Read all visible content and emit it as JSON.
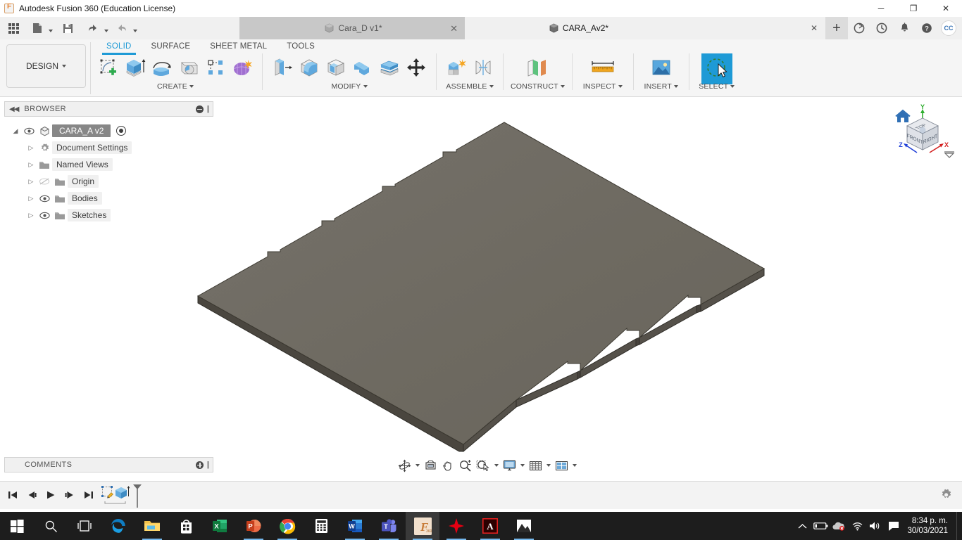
{
  "window": {
    "title": "Autodesk Fusion 360 (Education License)",
    "app_icon": "fusion-logo-icon",
    "minimize": "─",
    "maximize": "❐",
    "close": "✕"
  },
  "quick_access": {
    "grid_label": "app-grid",
    "new_label": "new-document",
    "save_label": "save",
    "undo_label": "undo",
    "redo_label": "redo"
  },
  "document_tabs": [
    {
      "label": "Cara_D v1*",
      "active": false,
      "close": "✕"
    },
    {
      "label": "CARA_Av2*",
      "active": true,
      "close": "✕"
    }
  ],
  "tab_actions": {
    "new_tab": "+",
    "extensions": "extensions-icon",
    "job_status": "job-status-icon",
    "notifications": "bell-icon",
    "help": "help-icon",
    "account_initials": "CC"
  },
  "ribbon": {
    "workspace": "DESIGN",
    "workspace_caret": "▾",
    "environment_tabs": [
      {
        "label": "SOLID",
        "active": true
      },
      {
        "label": "SURFACE",
        "active": false
      },
      {
        "label": "SHEET METAL",
        "active": false
      },
      {
        "label": "TOOLS",
        "active": false
      }
    ],
    "panels": [
      {
        "label": "CREATE",
        "has_caret": true,
        "commands": [
          "create-sketch-icon",
          "extrude-icon",
          "revolve-icon",
          "sweep-icon",
          "pattern-icon",
          "form-icon"
        ]
      },
      {
        "label": "MODIFY",
        "has_caret": true,
        "commands": [
          "press-pull-icon",
          "fillet-icon",
          "shell-icon",
          "combine-icon",
          "split-face-icon",
          "move-copy-icon"
        ]
      },
      {
        "label": "ASSEMBLE",
        "has_caret": true,
        "commands": [
          "new-component-icon",
          "joint-icon"
        ]
      },
      {
        "label": "CONSTRUCT",
        "has_caret": true,
        "commands": [
          "offset-plane-icon"
        ]
      },
      {
        "label": "INSPECT",
        "has_caret": true,
        "commands": [
          "measure-icon"
        ]
      },
      {
        "label": "INSERT",
        "has_caret": true,
        "commands": [
          "insert-image-icon"
        ]
      },
      {
        "label": "SELECT",
        "has_caret": true,
        "commands": [
          "select-tool-icon"
        ],
        "selected": true
      }
    ]
  },
  "browser": {
    "title": "BROWSER",
    "collapse_icon": "collapse-left-icon",
    "minimize_icon": "minimize-icon",
    "tree": [
      {
        "label": "CARA_A v2",
        "level": 0,
        "eye": true,
        "icon": "component-cube-icon",
        "selected": true,
        "radio": true
      },
      {
        "label": "Document Settings",
        "level": 1,
        "eye": false,
        "icon": "gear-icon"
      },
      {
        "label": "Named Views",
        "level": 1,
        "eye": false,
        "icon": "folder-icon"
      },
      {
        "label": "Origin",
        "level": 2,
        "eye": true,
        "eye_off": true,
        "icon": "folder-icon"
      },
      {
        "label": "Bodies",
        "level": 2,
        "eye": true,
        "icon": "folder-icon"
      },
      {
        "label": "Sketches",
        "level": 2,
        "eye": true,
        "icon": "folder-icon"
      }
    ]
  },
  "comments": {
    "title": "COMMENTS",
    "add_icon": "add-comment-icon"
  },
  "canvas": {
    "model_name": "CARA_A plate body",
    "face_color_top": "#6e6a61",
    "face_color_side": "#4f4c46",
    "face_color_edge": "#3a3832",
    "background": "#ffffff"
  },
  "view_cube": {
    "home_icon": "home-icon",
    "faces": {
      "top": "TOP",
      "front": "FRONT",
      "right": "RIGHT"
    },
    "axes": [
      {
        "label": "X",
        "color": "#d32020"
      },
      {
        "label": "Y",
        "color": "#2fae2f"
      },
      {
        "label": "Z",
        "color": "#2040d8"
      }
    ],
    "menu_icon": "viewcube-menu-icon"
  },
  "nav_bar": {
    "buttons": [
      {
        "name": "orbit-icon",
        "caret": true
      },
      {
        "name": "look-at-icon",
        "caret": false
      },
      {
        "name": "pan-icon",
        "caret": false
      },
      {
        "name": "zoom-icon",
        "caret": false
      },
      {
        "name": "zoom-window-icon",
        "caret": true
      },
      {
        "name": "display-settings-icon",
        "caret": true
      },
      {
        "name": "grid-snaps-icon",
        "caret": true
      },
      {
        "name": "viewports-icon",
        "caret": true
      }
    ]
  },
  "timeline": {
    "buttons": [
      "go-to-beginning-icon",
      "step-back-icon",
      "play-icon",
      "step-forward-icon",
      "go-to-end-icon"
    ],
    "features": [
      {
        "name": "sketch-feature-icon"
      },
      {
        "name": "extrude-feature-icon"
      }
    ],
    "marker": "timeline-marker",
    "settings": "timeline-settings-gear-icon"
  },
  "taskbar": {
    "items": [
      {
        "name": "start-button-icon",
        "running": false
      },
      {
        "name": "search-icon",
        "running": false
      },
      {
        "name": "task-view-icon",
        "running": false
      },
      {
        "name": "microsoft-edge-icon",
        "running": false
      },
      {
        "name": "file-explorer-icon",
        "running": true
      },
      {
        "name": "microsoft-store-icon",
        "running": false
      },
      {
        "name": "excel-icon",
        "running": false
      },
      {
        "name": "powerpoint-icon",
        "running": true
      },
      {
        "name": "google-chrome-icon",
        "running": true
      },
      {
        "name": "calculator-icon",
        "running": false
      },
      {
        "name": "word-icon",
        "running": true
      },
      {
        "name": "microsoft-teams-icon",
        "running": true
      },
      {
        "name": "fusion-360-icon",
        "running": true,
        "active": true
      },
      {
        "name": "red-star-app-icon",
        "running": true
      },
      {
        "name": "adobe-acrobat-icon",
        "running": true
      },
      {
        "name": "photos-icon",
        "running": true
      }
    ],
    "tray": {
      "overflow": "show-hidden-icons-chevron",
      "battery": "battery-icon",
      "onedrive": "onedrive-error-icon",
      "wifi": "wifi-icon",
      "volume": "volume-icon",
      "action_center": "action-center-icon",
      "time": "8:34 p. m.",
      "date": "30/03/2021"
    }
  }
}
